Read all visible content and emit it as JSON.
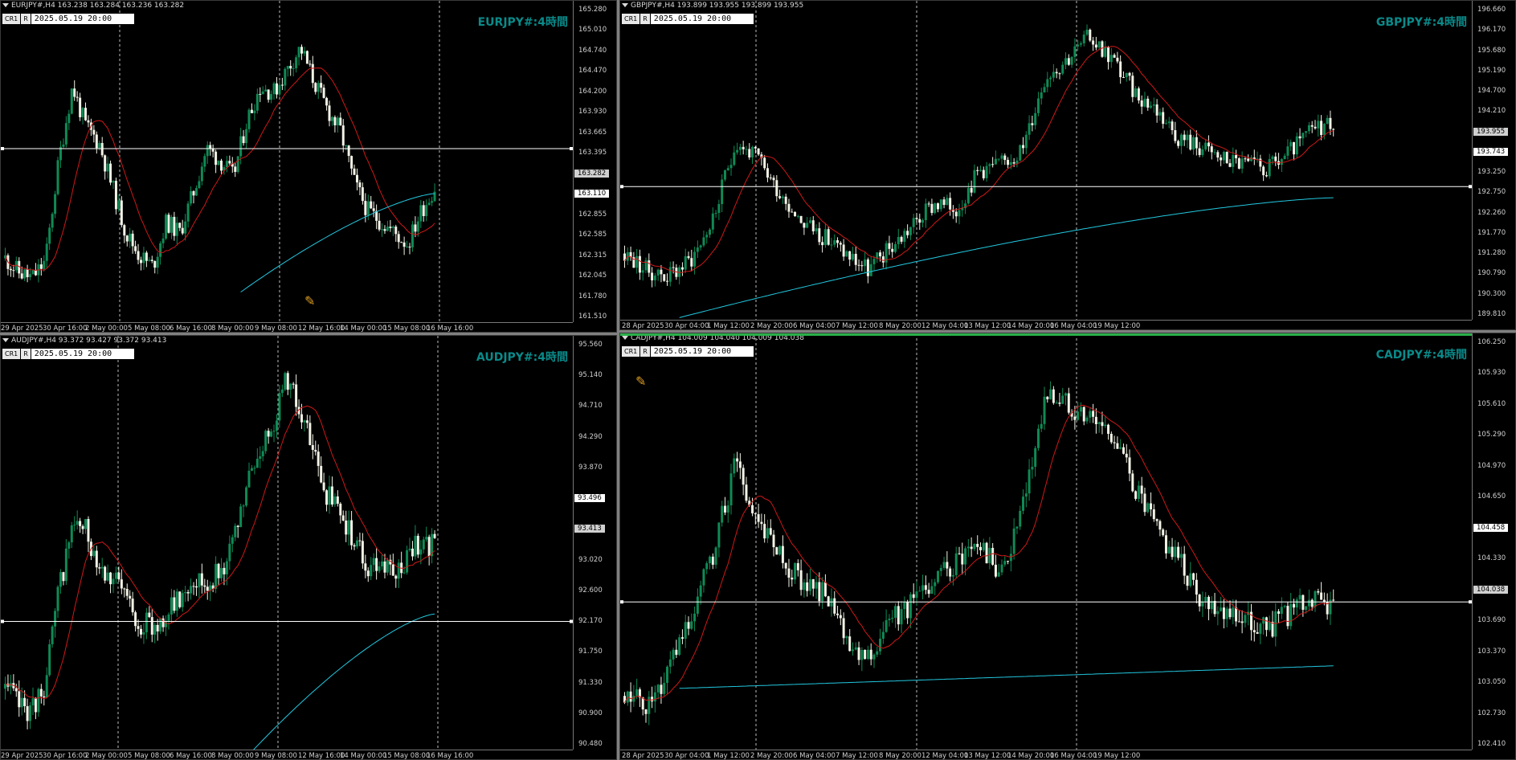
{
  "panels": [
    {
      "id": "eurjpy",
      "header": "EURJPY#,H4  163.238 163.284 163.236 163.282",
      "badges": [
        "CR1",
        "R"
      ],
      "datetime": "2025.05.19 20:00",
      "title": "EURJPY#:4時間",
      "price_labels": [
        "165.280",
        "165.010",
        "164.740",
        "164.470",
        "164.200",
        "163.930",
        "163.665",
        "163.395",
        "163.282",
        "163.110",
        "162.855",
        "162.585",
        "162.315",
        "162.045",
        "161.780",
        "161.510"
      ],
      "bid": "163.282",
      "line_price": "163.110",
      "time_labels": [
        "29 Apr 2025",
        "30 Apr 16:00",
        "2 May 00:00",
        "5 May 08:00",
        "6 May 16:00",
        "8 May 00:00",
        "9 May 08:00",
        "12 May 16:00",
        "14 May 00:00",
        "15 May 08:00",
        "16 May 16:00"
      ],
      "has_pencil": true
    },
    {
      "id": "gbpjpy",
      "header": "GBPJPY#,H4  193.899 193.955 193.899 193.955",
      "badges": [
        "CR1",
        "R"
      ],
      "datetime": "2025.05.19 20:00",
      "title": "GBPJPY#:4時間",
      "price_labels": [
        "196.660",
        "196.170",
        "195.680",
        "195.190",
        "194.700",
        "194.210",
        "193.955",
        "193.743",
        "193.250",
        "192.750",
        "192.260",
        "191.770",
        "191.280",
        "190.790",
        "190.300",
        "189.810"
      ],
      "bid": "193.955",
      "line_price": "193.743",
      "time_labels": [
        "28 Apr 2025",
        "30 Apr 04:00",
        "1 May 12:00",
        "2 May 20:00",
        "6 May 04:00",
        "7 May 12:00",
        "8 May 20:00",
        "12 May 04:00",
        "13 May 12:00",
        "14 May 20:00",
        "16 May 04:00",
        "19 May 12:00"
      ],
      "has_pencil": false
    },
    {
      "id": "audjpy",
      "header": "AUDJPY#,H4  93.372 93.427 93.372 93.413",
      "badges": [
        "CR1",
        "R"
      ],
      "datetime": "2025.05.19 20:00",
      "title": "AUDJPY#:4時間",
      "price_labels": [
        "95.560",
        "95.140",
        "94.710",
        "94.290",
        "93.870",
        "93.496",
        "93.413",
        "93.020",
        "92.600",
        "92.170",
        "91.750",
        "91.330",
        "90.900",
        "90.480"
      ],
      "bid": "93.413",
      "line_price": "93.496",
      "time_labels": [
        "29 Apr 2025",
        "30 Apr 16:00",
        "2 May 00:00",
        "5 May 08:00",
        "6 May 16:00",
        "8 May 00:00",
        "9 May 08:00",
        "12 May 16:00",
        "14 May 00:00",
        "15 May 08:00",
        "16 May 16:00"
      ],
      "has_pencil": false
    },
    {
      "id": "cadjpy",
      "header": "CADJPY#,H4  104.009 104.040 104.009 104.038",
      "badges": [
        "CR1",
        "R"
      ],
      "datetime": "2025.05.19 20:00",
      "title": "CADJPY#:4時間",
      "price_labels": [
        "106.250",
        "105.930",
        "105.610",
        "105.290",
        "104.970",
        "104.650",
        "104.458",
        "104.330",
        "104.038",
        "103.690",
        "103.370",
        "103.050",
        "102.730",
        "102.410"
      ],
      "bid": "104.038",
      "line_price": "104.458",
      "time_labels": [
        "28 Apr 2025",
        "30 Apr 04:00",
        "1 May 12:00",
        "2 May 20:00",
        "6 May 04:00",
        "7 May 12:00",
        "8 May 20:00",
        "12 May 04:00",
        "13 May 12:00",
        "14 May 20:00",
        "16 May 04:00",
        "19 May 12:00"
      ],
      "has_pencil": true
    }
  ],
  "colors": {
    "bull": "#0f8a55",
    "bear": "#f2f2e6",
    "ma_fast": "#d01818",
    "ma_slow": "#22c8e0",
    "hline": "#ffffff",
    "vline": "#bbbbbb",
    "title": "#0a8a8a"
  },
  "icons": {
    "pencil": "pencil-icon",
    "menu": "triangle-down-icon"
  }
}
